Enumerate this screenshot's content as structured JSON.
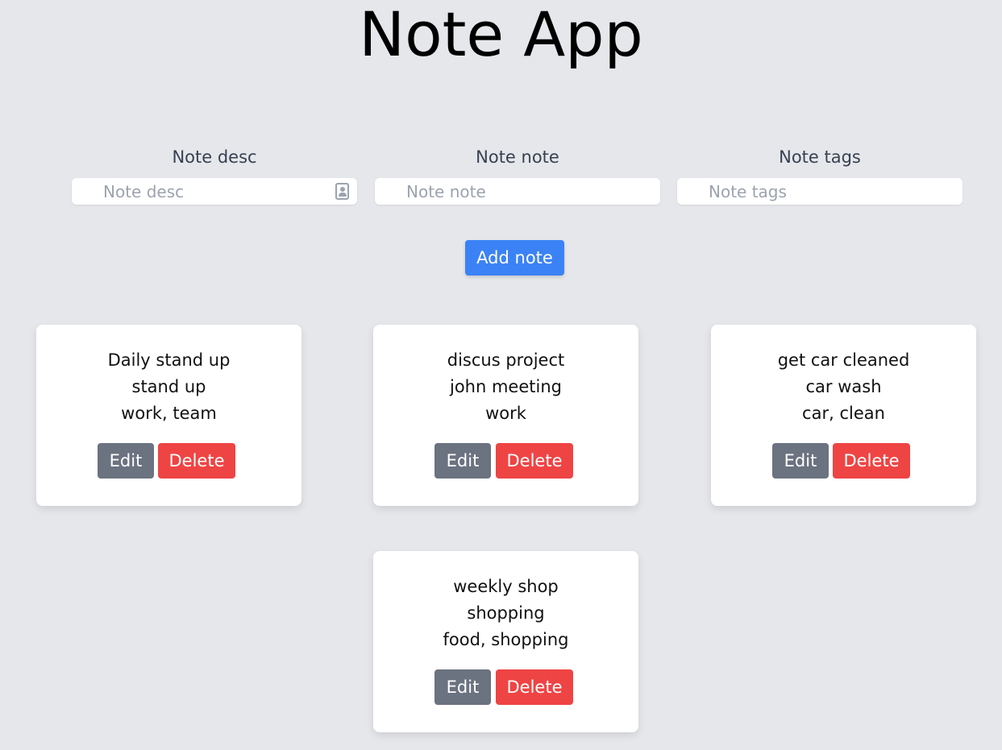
{
  "app": {
    "title": "Note App"
  },
  "form": {
    "desc": {
      "label": "Note desc",
      "placeholder": "Note desc",
      "value": ""
    },
    "note": {
      "label": "Note note",
      "placeholder": "Note note",
      "value": ""
    },
    "tags": {
      "label": "Note tags",
      "placeholder": "Note tags",
      "value": ""
    },
    "add_label": "Add note"
  },
  "colors": {
    "background": "#e5e7eb",
    "primary": "#3b82f6",
    "edit": "#6b7280",
    "delete": "#ef4444"
  },
  "notes": [
    {
      "desc": "Daily stand up",
      "note": "stand up",
      "tags": "work, team",
      "edit_label": "Edit",
      "delete_label": "Delete"
    },
    {
      "desc": "discus project",
      "note": "john meeting",
      "tags": "work",
      "edit_label": "Edit",
      "delete_label": "Delete"
    },
    {
      "desc": "get car cleaned",
      "note": "car wash",
      "tags": "car, clean",
      "edit_label": "Edit",
      "delete_label": "Delete"
    },
    {
      "desc": "weekly shop",
      "note": "shopping",
      "tags": "food, shopping",
      "edit_label": "Edit",
      "delete_label": "Delete"
    }
  ]
}
